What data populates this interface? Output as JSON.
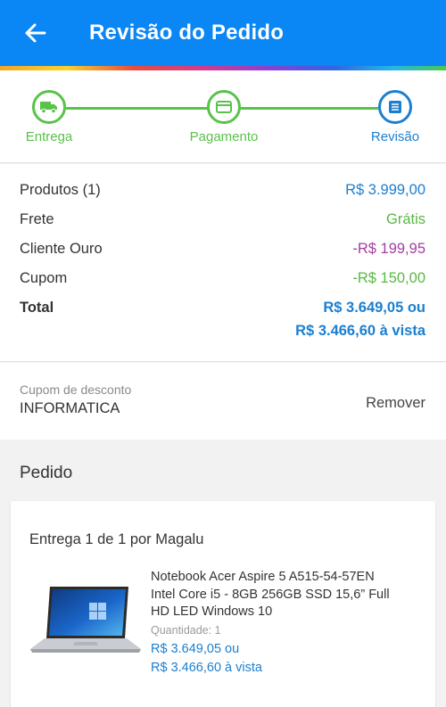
{
  "header": {
    "title": "Revisão do Pedido",
    "back_icon": "arrow-left-icon"
  },
  "stepper": {
    "steps": [
      {
        "label": "Entrega",
        "icon": "truck-icon",
        "state": "done"
      },
      {
        "label": "Pagamento",
        "icon": "credit-card-icon",
        "state": "done"
      },
      {
        "label": "Revisão",
        "icon": "list-icon",
        "state": "active"
      }
    ]
  },
  "summary": {
    "products_label": "Produtos (1)",
    "products_value": "R$ 3.999,00",
    "shipping_label": "Frete",
    "shipping_value": "Grátis",
    "gold_label": "Cliente Ouro",
    "gold_value": "-R$ 199,95",
    "coupon_label": "Cupom",
    "coupon_value": "-R$ 150,00",
    "total_label": "Total",
    "total_installments": "R$ 3.649,05 ou",
    "total_cash": "R$ 3.466,60 à vista"
  },
  "coupon": {
    "label": "Cupom de desconto",
    "code": "INFORMATICA",
    "remove_label": "Remover"
  },
  "order": {
    "title": "Pedido",
    "delivery_title": "Entrega 1 de 1 por Magalu",
    "product": {
      "name_line1": "Notebook Acer Aspire 5 A515-54-57EN",
      "name_line2": "Intel Core i5 - 8GB 256GB SSD 15,6” Full",
      "name_line3": "HD LED Windows 10",
      "quantity": "Quantidade:  1",
      "price": "R$ 3.649,05 ou",
      "price_cash": "R$ 3.466,60 à vista"
    }
  },
  "colors": {
    "primary": "#0a86f5",
    "step_green": "#59c24a",
    "active_blue": "#1b7fd0",
    "discount_purple": "#a43ea0"
  }
}
